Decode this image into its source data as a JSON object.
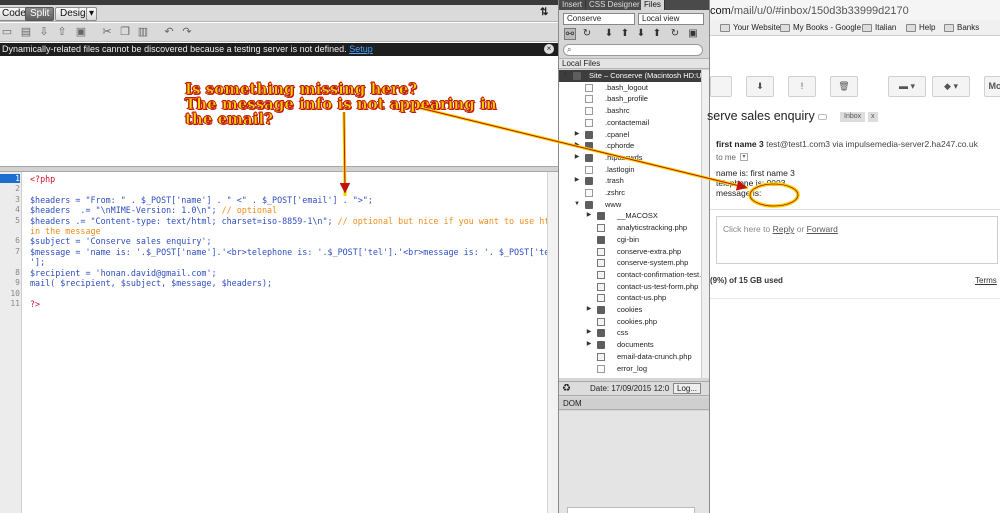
{
  "toolbar": {
    "code_label": "Code",
    "split_label": "Split",
    "design_label": "Design"
  },
  "infobar": {
    "message": "Dynamically-related files cannot be discovered because a testing server is not defined.",
    "link": "Setup"
  },
  "annotation": {
    "line1": "Is something missing here?",
    "line2": "The message info is not appearing in",
    "line3": "the email?",
    "color": "#f3d400",
    "outline_color": "#c0140b"
  },
  "code": {
    "line_numbers": [
      "1",
      "2",
      "3",
      "4",
      "5",
      "6",
      "7",
      "8",
      "9",
      "10",
      "11"
    ],
    "open_tag": "<?php",
    "l3": "$headers = \"From: \" . $_POST['name'] . \" <\" . $_POST['email'] . \">\";",
    "l4_code": "$headers  .= \"\\nMIME-Version: 1.0\\n\";",
    "l4_comment": " // optional",
    "l5_code": "$headers .= \"Content-type: text/html; charset=iso-8859-1\\n\";",
    "l5_comment": " // optional but nice if you want to use html",
    "l5_comment_wrap": "in the message",
    "l6": "$subject = 'Conserve sales enquiry';",
    "l7": "$message = 'name is: '.$_POST['name'].'<br>telephone is: '.$_POST['tel'].'<br>message is: '. $_POST['textbox",
    "l7_wrap": "'];",
    "l8": "$recipient = 'honan.david@gmail.com';",
    "l9": "mail( $recipient, $subject, $message, $headers);",
    "close_tag": "?>"
  },
  "panel": {
    "tabs": [
      "Insert",
      "CSS Designer",
      "Files"
    ],
    "site_select": "Conserve",
    "view_select": "Local view",
    "local_files_label": "Local Files",
    "tree": [
      {
        "name": "Site – Conserve (Macintosh HD:Use",
        "depth": 0,
        "type": "root",
        "expand": "▼"
      },
      {
        "name": ".bash_logout",
        "depth": 1,
        "type": "file",
        "expand": ""
      },
      {
        "name": ".bash_profile",
        "depth": 1,
        "type": "file",
        "expand": ""
      },
      {
        "name": ".bashrc",
        "depth": 1,
        "type": "file",
        "expand": ""
      },
      {
        "name": ".contactemail",
        "depth": 1,
        "type": "file",
        "expand": ""
      },
      {
        "name": ".cpanel",
        "depth": 1,
        "type": "folder",
        "expand": "▶"
      },
      {
        "name": ".cphorde",
        "depth": 1,
        "type": "folder",
        "expand": "▶"
      },
      {
        "name": ".htpasswds",
        "depth": 1,
        "type": "folder",
        "expand": "▶"
      },
      {
        "name": ".lastlogin",
        "depth": 1,
        "type": "file",
        "expand": ""
      },
      {
        "name": ".trash",
        "depth": 1,
        "type": "folder",
        "expand": "▶"
      },
      {
        "name": ".zshrc",
        "depth": 1,
        "type": "file",
        "expand": ""
      },
      {
        "name": "www",
        "depth": 1,
        "type": "folder",
        "expand": "▼"
      },
      {
        "name": "__MACOSX",
        "depth": 2,
        "type": "folder",
        "expand": "▶"
      },
      {
        "name": "analyticstracking.php",
        "depth": 2,
        "type": "php",
        "expand": ""
      },
      {
        "name": "cgi-bin",
        "depth": 2,
        "type": "folder",
        "expand": ""
      },
      {
        "name": "conserve-extra.php",
        "depth": 2,
        "type": "php",
        "expand": ""
      },
      {
        "name": "conserve-system.php",
        "depth": 2,
        "type": "php",
        "expand": ""
      },
      {
        "name": "contact-confirmation-test.",
        "depth": 2,
        "type": "php",
        "expand": ""
      },
      {
        "name": "contact-us-test-form.php",
        "depth": 2,
        "type": "php",
        "expand": ""
      },
      {
        "name": "contact-us.php",
        "depth": 2,
        "type": "php",
        "expand": ""
      },
      {
        "name": "cookies",
        "depth": 2,
        "type": "folder",
        "expand": "▶"
      },
      {
        "name": "cookies.php",
        "depth": 2,
        "type": "php",
        "expand": ""
      },
      {
        "name": "css",
        "depth": 2,
        "type": "folder",
        "expand": "▶"
      },
      {
        "name": "documents",
        "depth": 2,
        "type": "folder",
        "expand": "▶"
      },
      {
        "name": "email-data-crunch.php",
        "depth": 2,
        "type": "php",
        "expand": ""
      },
      {
        "name": "error_log",
        "depth": 2,
        "type": "file",
        "expand": ""
      }
    ],
    "status_date": "Date: 17/09/2015 12:0",
    "log_button": "Log...",
    "dom_label": "DOM"
  },
  "browser": {
    "url_prefix": "com",
    "url_rest": "/mail/u/0/#inbox/150d3b33999d2170",
    "bookmarks": [
      "Your Websites",
      "My Books - Google",
      "Italian",
      "Help",
      "Banks"
    ],
    "toolbar_more": "Mo",
    "subject": "serve sales enquiry",
    "label_inbox": "Inbox",
    "label_x": "x",
    "sender_name": "first name 3",
    "sender_email": "test@test1.com3 via impulsemedia-server2.ha247.co.uk",
    "to_me": "to me",
    "body_name": "name is: first name 3",
    "body_tel": "telephone is: 0003",
    "body_msg": "message is:",
    "reply_prefix": "Click here to",
    "reply_link": "Reply",
    "reply_or": "or",
    "forward_link": "Forward",
    "storage": "(9%) of 15 GB used",
    "terms": "Terms"
  }
}
